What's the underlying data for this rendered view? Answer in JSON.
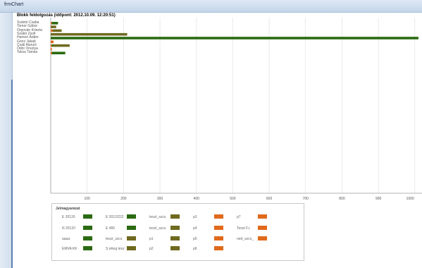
{
  "window": {
    "title": "frmChart"
  },
  "colors": {
    "green": "#2b6a12",
    "olive": "#6f6a1f",
    "orange": "#e06a1c",
    "grid": "#dcdcdc",
    "axis": "#999999"
  },
  "chart_data": {
    "type": "bar",
    "orientation": "horizontal",
    "title": "Blokk feldolgozás (időpont: 2012.10.09. 12:20:51)",
    "xlabel": "",
    "ylabel": "",
    "xlim": [
      0,
      1000
    ],
    "xticks": [
      100,
      200,
      300,
      400,
      500,
      600,
      700,
      800,
      900,
      1000
    ],
    "grid": true,
    "categories": [
      "Szántó Csaba",
      "Tomor Gábor",
      "Orgován Kriszta",
      "Szabó Zsolt",
      "Hamori Ádám",
      "Gonz Jakab",
      "Csáti Alenzó",
      "Ödör Orsolya",
      "Tokos Tamás"
    ],
    "bars": [
      {
        "segments": [
          {
            "value": 3,
            "color": "orange"
          },
          {
            "value": 17,
            "color": "green"
          }
        ]
      },
      {
        "segments": [
          {
            "value": 15,
            "color": "olive"
          }
        ]
      },
      {
        "segments": [
          {
            "value": 5,
            "color": "orange"
          },
          {
            "value": 25,
            "color": "olive"
          }
        ]
      },
      {
        "segments": [
          {
            "value": 210,
            "color": "olive"
          }
        ]
      },
      {
        "segments": [
          {
            "value": 1010,
            "color": "green"
          }
        ]
      },
      {
        "segments": [
          {
            "value": 8,
            "color": "orange"
          }
        ]
      },
      {
        "segments": [
          {
            "value": 3,
            "color": "orange"
          },
          {
            "value": 4,
            "color": "green"
          },
          {
            "value": 45,
            "color": "olive"
          }
        ]
      },
      {
        "segments": [
          {
            "value": 3,
            "color": "orange"
          }
        ]
      },
      {
        "segments": [
          {
            "value": 3,
            "color": "orange"
          },
          {
            "value": 37,
            "color": "green"
          }
        ]
      }
    ]
  },
  "legend": {
    "title": "Jelmagyarázat",
    "columns": [
      [
        {
          "label": "E 2012/I",
          "color": "green"
        },
        {
          "label": "N 2012/I",
          "color": "green"
        },
        {
          "label": "aaaa",
          "color": "green"
        },
        {
          "label": "EMVA KK",
          "color": "green"
        }
      ],
      [
        {
          "label": "E 2012/222",
          "color": "green"
        },
        {
          "label": "E 466",
          "color": "green"
        },
        {
          "label": "teszt_szcs",
          "color": "olive"
        },
        {
          "label": "S.réteg tesz",
          "color": "olive"
        }
      ],
      [
        {
          "label": "teszt_szcs",
          "color": "olive"
        },
        {
          "label": "teszt_szcs",
          "color": "olive"
        },
        {
          "label": "p1",
          "color": "olive"
        },
        {
          "label": "p2",
          "color": "olive"
        }
      ],
      [
        {
          "label": "p3",
          "color": "orange"
        },
        {
          "label": "p4",
          "color": "orange"
        },
        {
          "label": "p5",
          "color": "orange"
        },
        {
          "label": "p6",
          "color": "orange"
        }
      ],
      [
        {
          "label": "p7",
          "color": "orange"
        },
        {
          "label": "Teszt F.i.",
          "color": "orange"
        },
        {
          "label": "ned_szcs_",
          "color": "orange"
        }
      ]
    ]
  }
}
